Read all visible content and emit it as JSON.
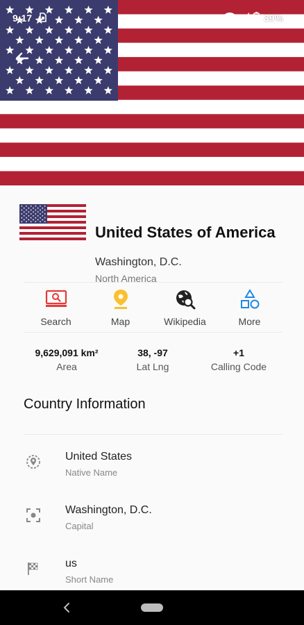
{
  "status_bar": {
    "time": "9:17",
    "battery": "39%"
  },
  "country": {
    "name": "United States of America",
    "capital": "Washington, D.C.",
    "region": "North America"
  },
  "actions": [
    {
      "label": "Search",
      "icon": "search-monitor-icon",
      "color": "#e53935"
    },
    {
      "label": "Map",
      "icon": "map-pin-icon",
      "color": "#fbc02d"
    },
    {
      "label": "Wikipedia",
      "icon": "wikipedia-globe-icon",
      "color": "#222222"
    },
    {
      "label": "More",
      "icon": "shapes-icon",
      "color": "#1e88e5"
    }
  ],
  "stats": [
    {
      "value": "9,629,091 km²",
      "label": "Area"
    },
    {
      "value": "38, -97",
      "label": "Lat Lng"
    },
    {
      "value": "+1",
      "label": "Calling Code"
    }
  ],
  "section": {
    "title": "Country Information"
  },
  "info": [
    {
      "value": "United States",
      "label": "Native Name",
      "icon": "location-target-icon"
    },
    {
      "value": "Washington, D.C.",
      "label": "Capital",
      "icon": "center-focus-icon"
    },
    {
      "value": "us",
      "label": "Short Name",
      "icon": "checkered-flag-icon"
    }
  ],
  "colors": {
    "flag_red": "#b22234",
    "flag_blue": "#3c3b6e",
    "flag_white": "#ffffff"
  }
}
